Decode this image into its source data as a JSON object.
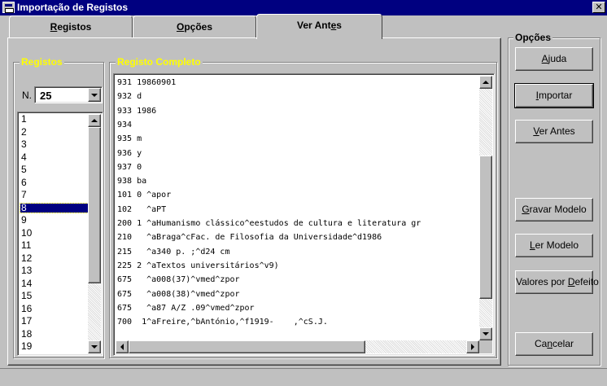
{
  "window": {
    "title": "Importação de Registos",
    "close_glyph": "✕"
  },
  "tabs": [
    {
      "label": "Registos",
      "mnemonic": "R",
      "rest": "egistos"
    },
    {
      "label": "Opções",
      "mnemonic": "O",
      "rest": "pções"
    },
    {
      "label": "Ver Antes",
      "pre": "Ver Ant",
      "mnemonic": "e",
      "rest": "s",
      "active": true
    }
  ],
  "registos_panel": {
    "title": "Registos",
    "n_label": "N.",
    "n_value": "25",
    "items": [
      "1",
      "2",
      "3",
      "4",
      "5",
      "6",
      "7",
      "8",
      "9",
      "10",
      "11",
      "12",
      "13",
      "14",
      "15",
      "16",
      "17",
      "18",
      "19"
    ],
    "selected_item": "8"
  },
  "registo_completo": {
    "title": "Registo Completo",
    "lines": [
      "931 19860901",
      "932 d",
      "933 1986",
      "934",
      "935 m",
      "936 y",
      "937 0",
      "938 ba",
      "101 0 ^apor",
      "102   ^aPT",
      "200 1 ^aHumanismo clássico^eestudos de cultura e literatura gr",
      "210   ^aBraga^cFac. de Filosofia da Universidade^d1986",
      "215   ^a340 p. ;^d24 cm",
      "225 2 ^aTextos universitários^v9)",
      "675   ^a008(37)^vmed^zpor",
      "675   ^a008(38)^vmed^zpor",
      "675   ^a87 A/Z .09^vmed^zpor",
      "700  1^aFreire,^bAntónio,^f1919-    ,^cS.J."
    ]
  },
  "opcoes": {
    "title": "Opções",
    "buttons": [
      {
        "id": "ajuda",
        "label": "Ajuda",
        "pre": "",
        "mnemonic": "A",
        "rest": "juda"
      },
      {
        "id": "importar",
        "label": "Importar",
        "pre": "",
        "mnemonic": "I",
        "rest": "mportar"
      },
      {
        "id": "ver-antes",
        "label": "Ver Antes",
        "pre": "",
        "mnemonic": "V",
        "rest": "er Antes"
      },
      {
        "id": "gravar-modelo",
        "label": "Gravar Modelo",
        "pre": "",
        "mnemonic": "G",
        "rest": "ravar Modelo"
      },
      {
        "id": "ler-modelo",
        "label": "Ler Modelo",
        "pre": "",
        "mnemonic": "L",
        "rest": "er Modelo"
      },
      {
        "id": "valores-por-defeito",
        "label": "Valores por Defeito",
        "pre": "Valores por ",
        "mnemonic": "D",
        "rest": "efeito"
      },
      {
        "id": "cancelar",
        "label": "Cancelar",
        "pre": "Ca",
        "mnemonic": "n",
        "rest": "celar"
      }
    ]
  }
}
